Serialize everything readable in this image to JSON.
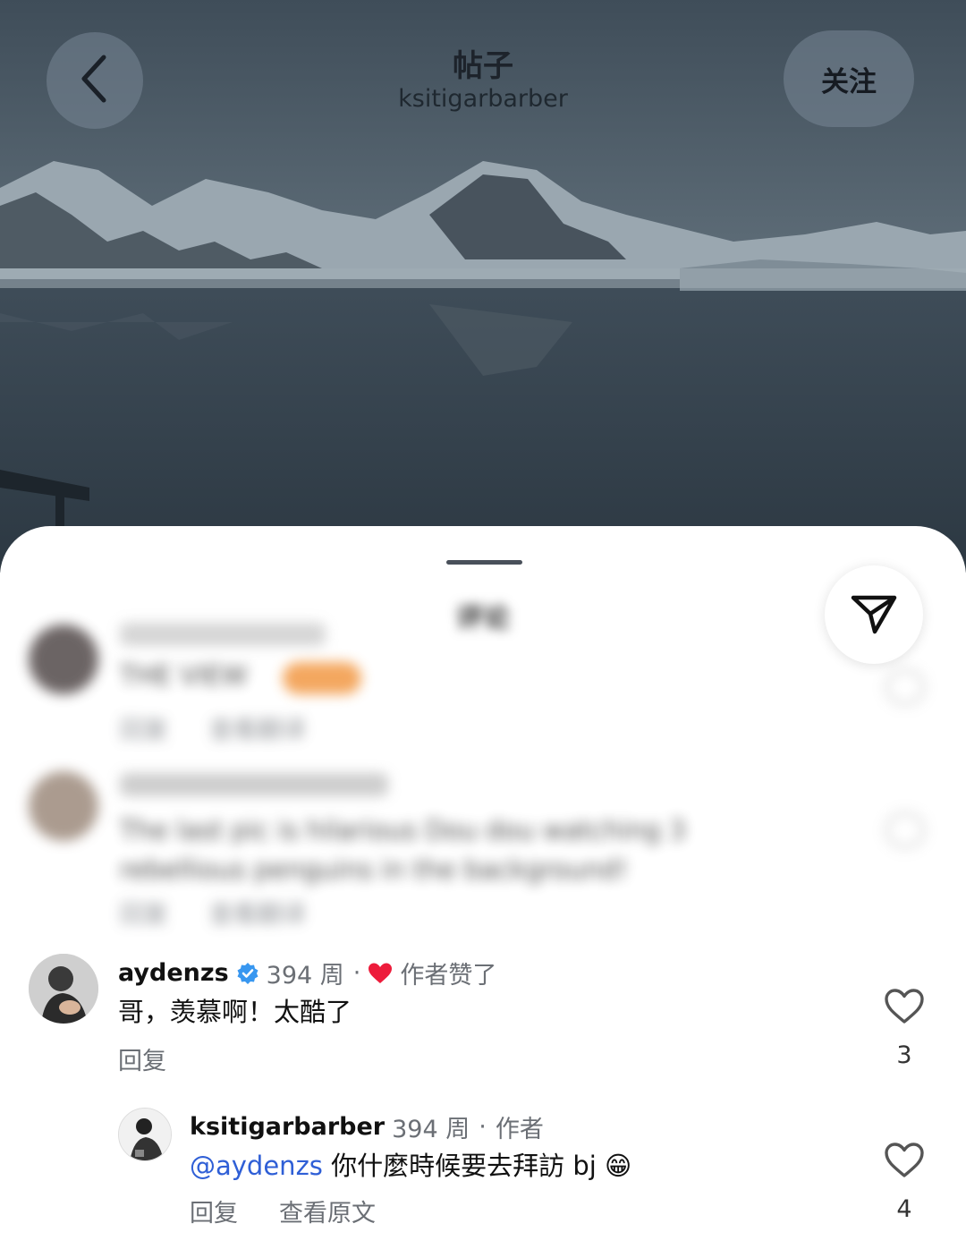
{
  "header": {
    "title": "帖子",
    "username": "ksitigarbarber",
    "follow_label": "关注"
  },
  "sheet": {
    "title": "评论"
  },
  "blurred_comments": [
    {
      "username": "",
      "text": "THE VIEW",
      "reply": "回复",
      "translate": "查看翻译"
    },
    {
      "username": "",
      "text": "The last pic is hilarious Dou dou watching 3 rebellious penguins in the background!",
      "reply": "回复",
      "translate": "查看翻译"
    }
  ],
  "comments": [
    {
      "username": "aydenzs",
      "verified": true,
      "time": "394 周",
      "separator": "·",
      "author_liked": "作者赞了",
      "text": "哥，羡慕啊！太酷了",
      "reply": "回复",
      "likes": "3",
      "replies": [
        {
          "username": "ksitigarbarber",
          "time": "394 周",
          "separator": "·",
          "author_badge": "作者",
          "mention": "@aydenzs",
          "text": " 你什麼時候要去拜訪 bj 😁",
          "reply": "回复",
          "see_original": "查看原文",
          "likes": "4"
        }
      ]
    }
  ],
  "colors": {
    "verified": "#3897f0",
    "heart_red": "#ed1c3b",
    "mention": "#2f5fd6"
  }
}
